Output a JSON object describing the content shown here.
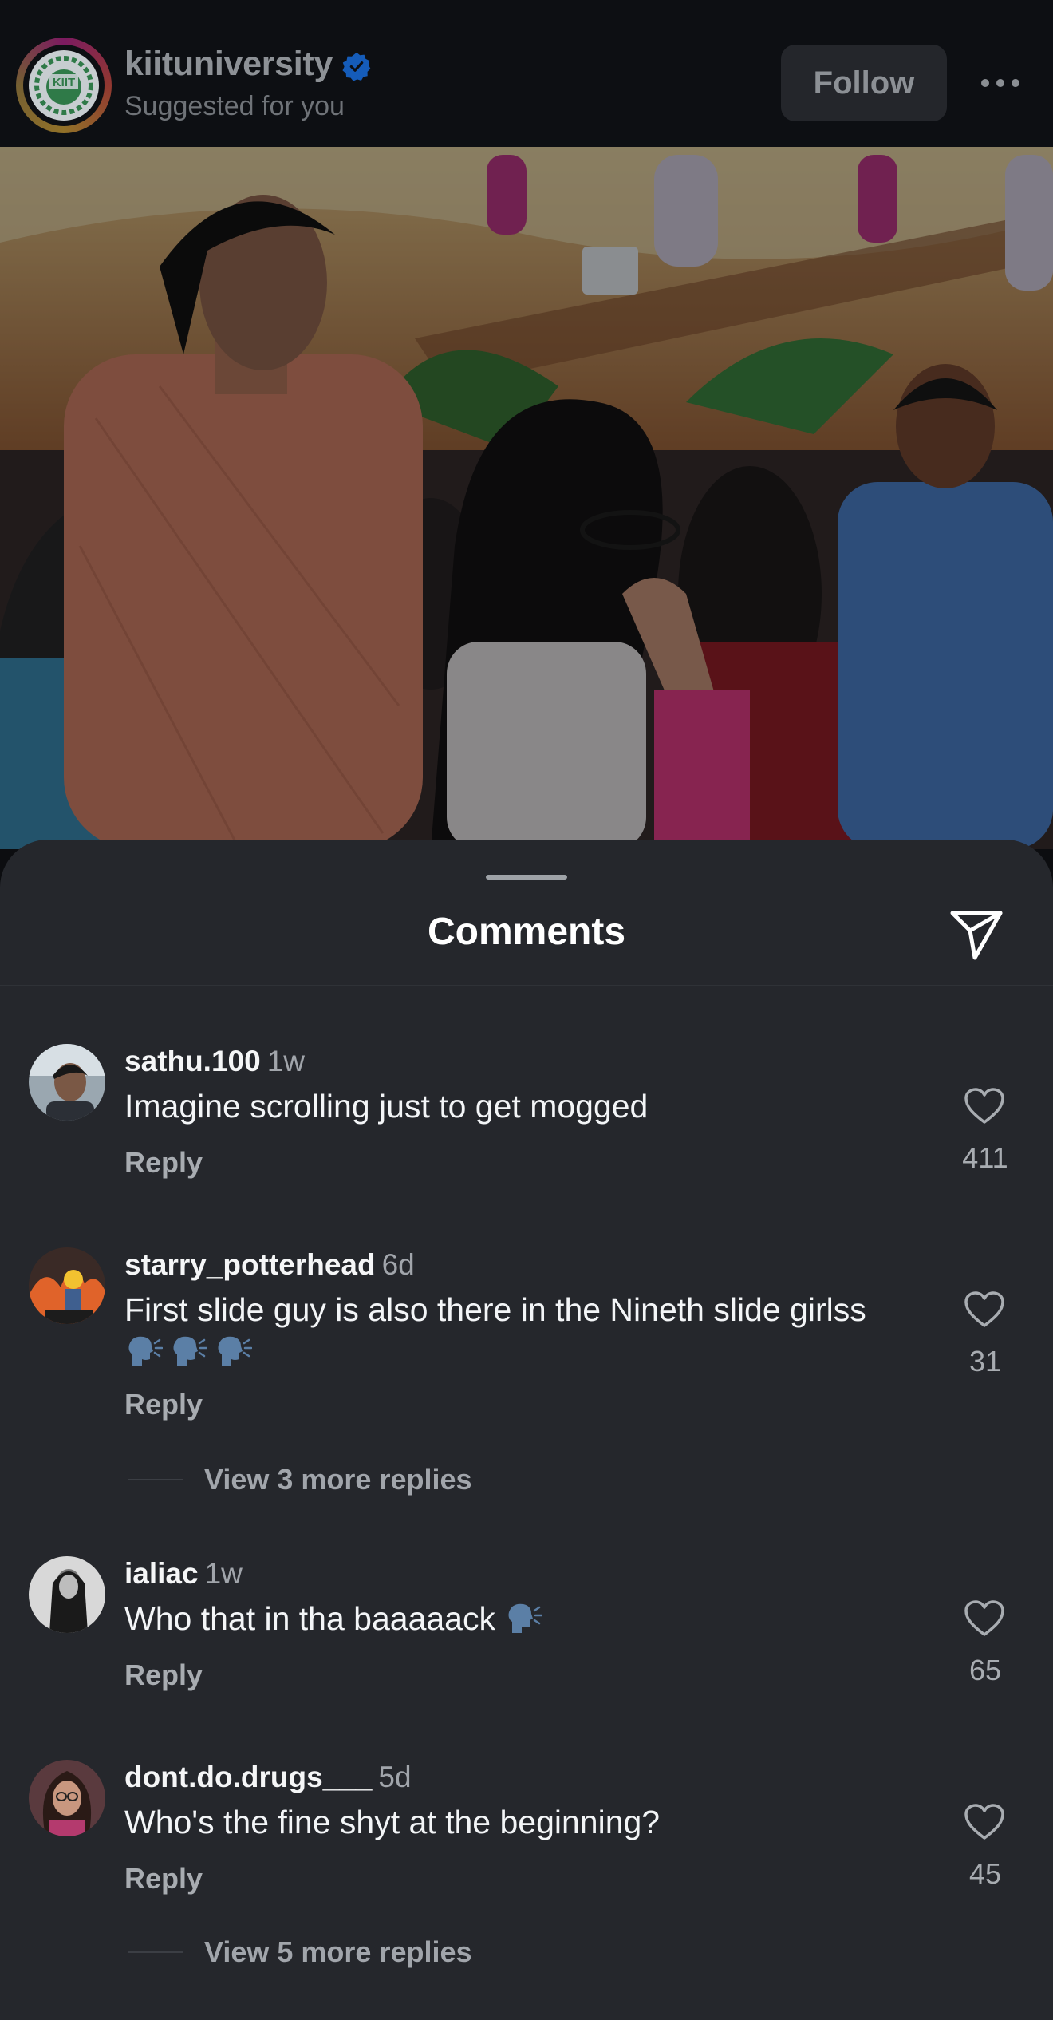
{
  "post_header": {
    "account_name": "kiituniversity",
    "subtitle": "Suggested for you",
    "follow_label": "Follow",
    "logo_text": "KIIT"
  },
  "comments_sheet": {
    "title": "Comments"
  },
  "comments": [
    {
      "username": "sathu.100",
      "time": "1w",
      "text": "Imagine scrolling just to get mogged",
      "reply_label": "Reply",
      "likes": "411"
    },
    {
      "username": "starry_potterhead",
      "time": "6d",
      "text": "First slide guy is also there in the Nineth slide girlss",
      "reply_label": "Reply",
      "likes": "31",
      "more_replies": "View 3 more replies"
    },
    {
      "username": "ialiac",
      "time": "1w",
      "text": "Who that in tha baaaaack",
      "reply_label": "Reply",
      "likes": "65"
    },
    {
      "username": "dont.do.drugs___",
      "time": "5d",
      "text": "Who's the fine shyt at the beginning?",
      "reply_label": "Reply",
      "likes": "45",
      "more_replies": "View 5 more replies"
    }
  ],
  "icons": {
    "verified": "verified-badge-icon",
    "more": "more-horizontal-icon",
    "share": "paper-plane-icon",
    "like": "heart-outline-icon",
    "speaking_head": "speaking-head-emoji"
  },
  "colors": {
    "background": "#0d0f13",
    "sheet": "#25272c",
    "verified": "#1877f2",
    "secondary_text": "#a8acb1"
  }
}
